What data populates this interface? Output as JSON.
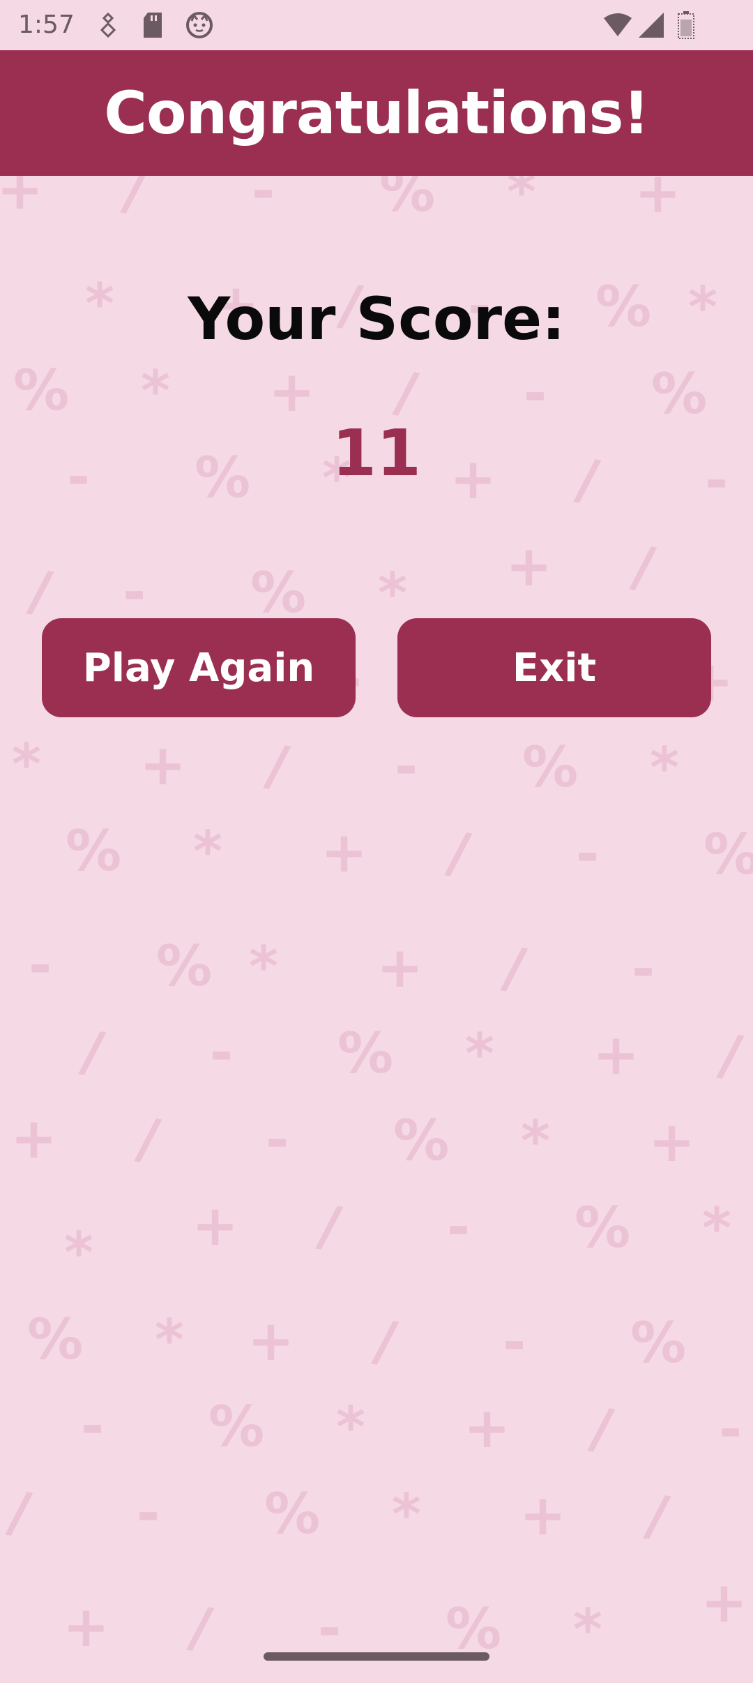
{
  "status_bar": {
    "time": "1:57",
    "icons": [
      "usb-debug-icon",
      "sd-card-icon",
      "cat-face-icon",
      "wifi-icon",
      "cell-signal-icon",
      "battery-icon"
    ]
  },
  "header": {
    "title": "Congratulations!"
  },
  "score": {
    "label": "Your Score:",
    "value": "11"
  },
  "buttons": {
    "play_again": "Play Again",
    "exit": "Exit"
  },
  "colors": {
    "primary": "#9a2f52",
    "background": "#f5d9e5",
    "pattern": "#ecc3d4"
  },
  "background_symbols": [
    "+",
    "-",
    "*",
    "/",
    "%"
  ]
}
